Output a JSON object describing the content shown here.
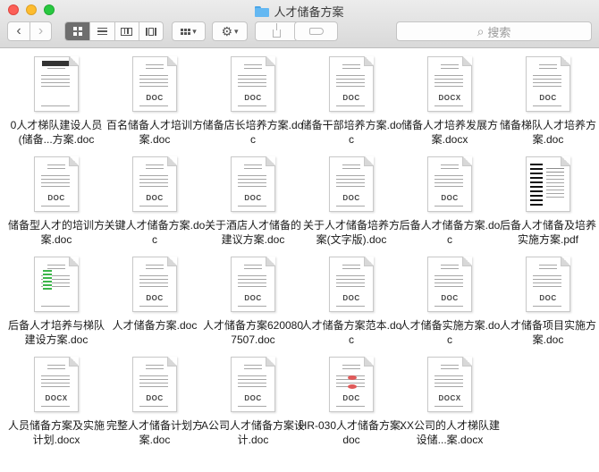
{
  "window": {
    "title": "人才储备方案",
    "search_placeholder": "搜索"
  },
  "toolbar": {
    "back_glyph": "‹",
    "forward_glyph": "›",
    "chevron_glyph": "▾",
    "gear_glyph": "⚙",
    "search_glyph": "⌕"
  },
  "files": [
    {
      "name": "0人才梯队建设人员(储备...方案.doc",
      "badge": "",
      "icon": "dark"
    },
    {
      "name": "百名储备人才培训方案.doc",
      "badge": "DOC",
      "icon": "plain"
    },
    {
      "name": "储备店长培养方案.doc",
      "badge": "DOC",
      "icon": "plain"
    },
    {
      "name": "储备干部培养方案.doc",
      "badge": "DOC",
      "icon": "plain"
    },
    {
      "name": "储备人才培养发展方案.docx",
      "badge": "DOCX",
      "icon": "plain"
    },
    {
      "name": "储备梯队人才培养方案.doc",
      "badge": "DOC",
      "icon": "plain"
    },
    {
      "name": "储备型人才的培训方案.doc",
      "badge": "DOC",
      "icon": "plain"
    },
    {
      "name": "关键人才储备方案.doc",
      "badge": "DOC",
      "icon": "plain"
    },
    {
      "name": "关于酒店人才储备的建议方案.doc",
      "badge": "DOC",
      "icon": "plain"
    },
    {
      "name": "关于人才储备培养方案(文字版).doc",
      "badge": "DOC",
      "icon": "plain"
    },
    {
      "name": "后备人才储备方案.doc",
      "badge": "DOC",
      "icon": "plain"
    },
    {
      "name": "后备人才储备及培养实施方案.pdf",
      "badge": "",
      "icon": "pdf"
    },
    {
      "name": "后备人才培养与梯队建设方案.doc",
      "badge": "",
      "icon": "green"
    },
    {
      "name": "人才储备方案.doc",
      "badge": "DOC",
      "icon": "plain"
    },
    {
      "name": "人才储备方案6200807507.doc",
      "badge": "DOC",
      "icon": "plain"
    },
    {
      "name": "人才储备方案范本.doc",
      "badge": "DOC",
      "icon": "plain"
    },
    {
      "name": "人才储备实施方案.doc",
      "badge": "DOC",
      "icon": "plain"
    },
    {
      "name": "人才储备项目实施方案.doc",
      "badge": "DOC",
      "icon": "plain"
    },
    {
      "name": "人员储备方案及实施计划.docx",
      "badge": "DOCX",
      "icon": "plain"
    },
    {
      "name": "完整人才储备计划方案.doc",
      "badge": "DOC",
      "icon": "plain"
    },
    {
      "name": "A公司人才储备方案设计.doc",
      "badge": "DOC",
      "icon": "plain"
    },
    {
      "name": "HR-030人才储备方案.doc",
      "badge": "DOC",
      "icon": "red"
    },
    {
      "name": "XX公司的人才梯队建设储...案.docx",
      "badge": "DOCX",
      "icon": "plain"
    }
  ]
}
